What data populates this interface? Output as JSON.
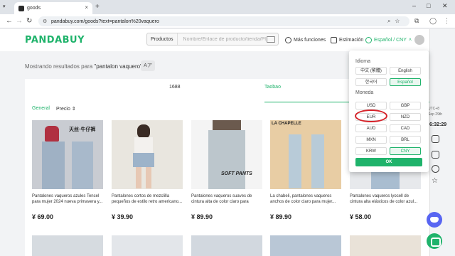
{
  "browser": {
    "tab_title": "goods",
    "url": "pandabuy.com/goods?text=pantalon%20vaquero",
    "new_tab": "+",
    "close": "×",
    "win_min": "–",
    "win_max": "□",
    "win_close": "✕"
  },
  "header": {
    "logo": "PANDABUY",
    "search_category": "Productos",
    "search_placeholder": "Nombre/Enlace de producto/tienda/Pl",
    "more_functions": "Más funciones",
    "estimate": "Estimación",
    "language_currency": "Español / CNY"
  },
  "results": {
    "prefix": "Mostrando resultados para ",
    "query": "\"pantalon vaquero\""
  },
  "source_tabs": [
    "1688",
    "Taobao"
  ],
  "sort": [
    "General",
    "Precio"
  ],
  "products": [
    {
      "title": "Pantalones vaqueros azules Tencel para mujer 2024 nueva primavera y...",
      "price": "¥ 69.00",
      "tag": "天丝·牛仔裤"
    },
    {
      "title": "Pantalones cortos de mezclilla pequeños de estilo retro americano...",
      "price": "¥ 39.90",
      "tag": ""
    },
    {
      "title": "Pantalones vaqueros suaves de cintura alta de color claro para mujer...",
      "price": "¥ 89.90",
      "tag": "SOFT PANTS"
    },
    {
      "title": "La chabeli, pantalones vaqueros anchos de color claro para mujer...",
      "price": "¥ 89.90",
      "tag": "LA CHAPELLE"
    },
    {
      "title": "Pantalones vaqueros lyocell de cintura alta elásticos de color azul...",
      "price": "¥ 58.00",
      "tag": ""
    }
  ],
  "popup": {
    "language_label": "Idioma",
    "languages": [
      "中文 (繁體)",
      "English",
      "한국어",
      "Español"
    ],
    "selected_language": "Español",
    "currency_label": "Moneda",
    "currencies": [
      "USD",
      "GBP",
      "EUR",
      "NZD",
      "AUD",
      "CAD",
      "MXN",
      "BRL",
      "KRW",
      "CNY"
    ],
    "selected_currency": "CNY",
    "ok_label": "OK"
  },
  "side": {
    "utc": "UTC+8",
    "date": "Sep 29th",
    "time": "6:32:29"
  },
  "colors": {
    "brand_green": "#1fb36b",
    "highlight_red": "#d6232a"
  }
}
